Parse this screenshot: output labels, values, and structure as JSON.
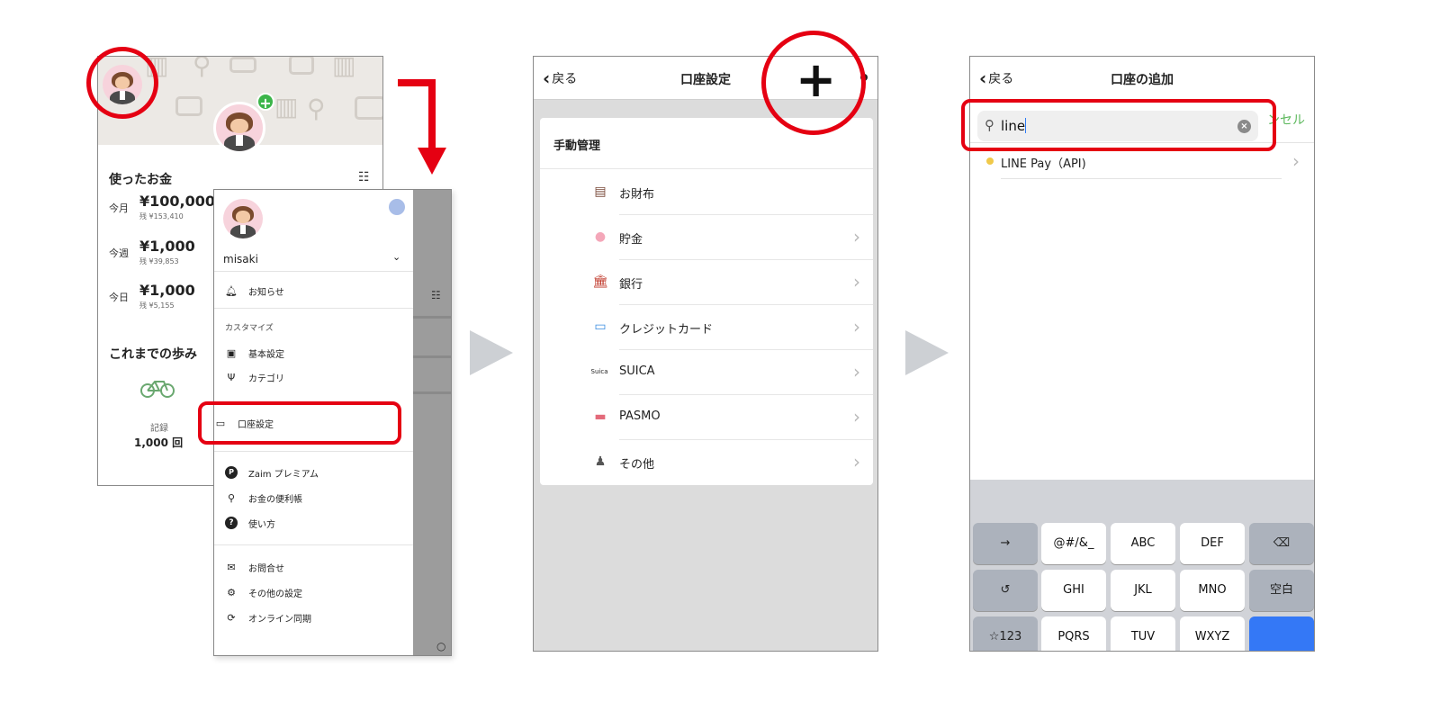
{
  "colors": {
    "highlight": "#e50012",
    "accent_green": "#5cb85c",
    "keyboard_blue": "#3478f6"
  },
  "screen1": {
    "section_spent": "使ったお金",
    "rows": [
      {
        "period": "今月",
        "amount": "¥100,000",
        "sub": "残 ¥153,410"
      },
      {
        "period": "今週",
        "amount": "¥1,000",
        "sub": "残 ¥39,853"
      },
      {
        "period": "今日",
        "amount": "¥1,000",
        "sub": "残 ¥5,155"
      }
    ],
    "section_history": "これまでの歩み",
    "record_label": "記録",
    "record_count": "1,000 回",
    "icons": [
      "avatar",
      "bicycle-icon",
      "filter-icon"
    ]
  },
  "drawer": {
    "username": "misaki",
    "items_top": [
      {
        "icon": "bell-icon",
        "label": "お知らせ"
      }
    ],
    "section_customize": "カスタマイズ",
    "items_customize": [
      {
        "icon": "calendar-icon",
        "label": "基本設定"
      },
      {
        "icon": "fork-knife-icon",
        "label": "カテゴリ"
      },
      {
        "icon": "card-icon",
        "label": "口座設定"
      }
    ],
    "items_more": [
      {
        "icon": "premium-icon",
        "label": "Zaim プレミアム"
      },
      {
        "icon": "search-icon",
        "label": "お金の便利帳"
      },
      {
        "icon": "help-icon",
        "label": "使い方"
      }
    ],
    "items_bottom": [
      {
        "icon": "mail-icon",
        "label": "お問合せ"
      },
      {
        "icon": "gear-icon",
        "label": "その他の設定"
      },
      {
        "icon": "sync-icon",
        "label": "オンライン同期"
      }
    ]
  },
  "screen2": {
    "back": "戻る",
    "title": "口座設定",
    "section": "手動管理",
    "accounts": [
      {
        "icon": "wallet-icon",
        "label": "お財布",
        "color": "#7a4a3a"
      },
      {
        "icon": "piggy-bank-icon",
        "label": "貯金",
        "color": "#f4a7b9"
      },
      {
        "icon": "bank-icon",
        "label": "銀行",
        "color": "#c0392b"
      },
      {
        "icon": "credit-card-icon",
        "label": "クレジットカード",
        "color": "#3a8de0"
      },
      {
        "icon": "suica-icon",
        "label": "SUICA",
        "color": "#333333"
      },
      {
        "icon": "pasmo-icon",
        "label": "PASMO",
        "color": "#e36a7a"
      },
      {
        "icon": "money-bag-icon",
        "label": "その他",
        "color": "#555555"
      }
    ]
  },
  "screen3": {
    "back": "戻る",
    "title": "口座の追加",
    "search_value": "line",
    "cancel": "ンセル",
    "result": "LINE Pay（API)",
    "keyboard": [
      [
        "→",
        "@#/&_",
        "ABC",
        "DEF",
        "⌫"
      ],
      [
        "↺",
        "GHI",
        "JKL",
        "MNO",
        "空白"
      ],
      [
        "☆123",
        "PQRS",
        "TUV",
        "WXYZ",
        ""
      ]
    ]
  }
}
